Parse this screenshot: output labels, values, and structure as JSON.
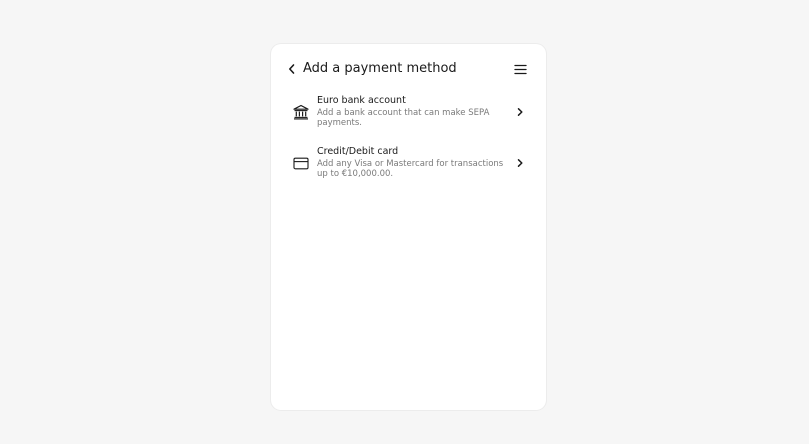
{
  "header": {
    "title": "Add a payment method",
    "back_icon": "chevron-left-icon",
    "menu_icon": "hamburger-menu-icon"
  },
  "options": [
    {
      "icon": "bank-icon",
      "title": "Euro bank account",
      "description": "Add a bank account that can make SEPA payments."
    },
    {
      "icon": "credit-card-icon",
      "title": "Credit/Debit card",
      "description": "Add any Visa or Mastercard for transactions up to €10,000.00."
    }
  ],
  "colors": {
    "background": "#f6f6f6",
    "card": "#ffffff",
    "text": "#1a1a1a",
    "muted_text": "#7a7a7a"
  }
}
